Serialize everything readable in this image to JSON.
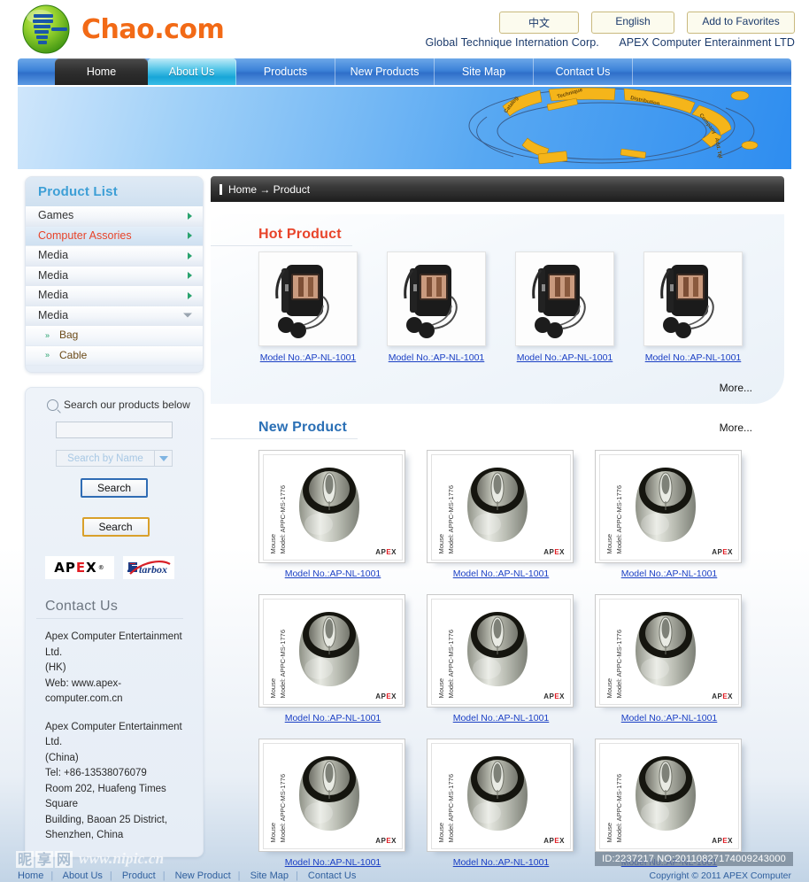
{
  "header": {
    "brand_name": "Chao.com",
    "lang_buttons": [
      {
        "label": "中文",
        "name": "lang-chinese-button"
      },
      {
        "label": "English",
        "name": "lang-english-button"
      },
      {
        "label": "Add to Favorites",
        "name": "add-to-favorites-button"
      }
    ],
    "corp_left": "Global Technique Internation Corp.",
    "corp_right": "APEX Computer Enterainment LTD"
  },
  "nav": {
    "items": [
      {
        "label": "Home",
        "state": "active"
      },
      {
        "label": "About Us",
        "state": "hover"
      },
      {
        "label": "Products",
        "state": "plain"
      },
      {
        "label": "New Products",
        "state": "plain"
      },
      {
        "label": "Site Map",
        "state": "plain"
      },
      {
        "label": "Contact Us",
        "state": "plain"
      }
    ]
  },
  "sidebar": {
    "panel_title": "Product List",
    "categories": [
      {
        "label": "Games",
        "selected": false,
        "expanded": false
      },
      {
        "label": "Computer Assories",
        "selected": true,
        "expanded": false
      },
      {
        "label": "Media",
        "selected": false,
        "expanded": false
      },
      {
        "label": "Media",
        "selected": false,
        "expanded": false
      },
      {
        "label": "Media",
        "selected": false,
        "expanded": false
      },
      {
        "label": "Media",
        "selected": false,
        "expanded": true
      }
    ],
    "subcategories": [
      {
        "label": "Bag"
      },
      {
        "label": "Cable"
      }
    ],
    "search": {
      "heading": "Search our products below",
      "input_value": "",
      "input_placeholder": "",
      "select_label": "Search by Name",
      "button_primary": "Search",
      "button_secondary": "Search"
    },
    "brands": {
      "apex": "APEX",
      "starbox": "Starbox"
    },
    "contact": {
      "title": "Contact Us",
      "lines_hk": [
        "Apex Computer Entertainment Ltd.",
        "(HK)",
        "Web: www.apex-computer.com.cn"
      ],
      "lines_cn": [
        "Apex Computer Entertainment Ltd.",
        "(China)",
        "Tel: +86-13538076079",
        "Room 202, Huafeng Times Square",
        "Building, Baoan 25 District,",
        "Shenzhen, China"
      ]
    }
  },
  "main": {
    "breadcrumb": "Home → Product",
    "hot_section": {
      "title": "Hot Product",
      "more_label": "More...",
      "products": [
        {
          "link_label": "Model No.:AP-NL-1001"
        },
        {
          "link_label": "Model No.:AP-NL-1001"
        },
        {
          "link_label": "Model No.:AP-NL-1001"
        },
        {
          "link_label": "Model No.:AP-NL-1001"
        }
      ]
    },
    "new_section": {
      "title": "New Product",
      "more_label": "More...",
      "image_caption_line1": "Mouse",
      "image_caption_line2": "Model: APPC-MS-1776",
      "image_brand": "APEX",
      "products": [
        {
          "link_label": "Model No.:AP-NL-1001"
        },
        {
          "link_label": "Model No.:AP-NL-1001"
        },
        {
          "link_label": "Model No.:AP-NL-1001"
        },
        {
          "link_label": "Model No.:AP-NL-1001"
        },
        {
          "link_label": "Model No.:AP-NL-1001"
        },
        {
          "link_label": "Model No.:AP-NL-1001"
        },
        {
          "link_label": "Model No.:AP-NL-1001"
        },
        {
          "link_label": "Model No.:AP-NL-1001"
        },
        {
          "link_label": "Model No.:AP-NL-1001"
        }
      ]
    }
  },
  "footer": {
    "links": [
      {
        "label": "Home"
      },
      {
        "label": "About Us"
      },
      {
        "label": "Product"
      },
      {
        "label": "New Product"
      },
      {
        "label": "Site Map"
      },
      {
        "label": "Contact Us"
      }
    ],
    "copyright": "Copyright © 2011 APEX Computer",
    "watermark_cjk": [
      "昵",
      "享",
      "网"
    ],
    "watermark_url": "www.nipic.cn",
    "watermark_id": "ID:2237217 NO:20110827174009243000"
  },
  "colors": {
    "brand_orange": "#f26a16",
    "nav_blue": "#3c82d8",
    "hot_red": "#e8442a",
    "new_blue": "#2a6fb5",
    "link_blue": "#1a3fc4",
    "panel_title_cyan": "#3d9fd6"
  }
}
